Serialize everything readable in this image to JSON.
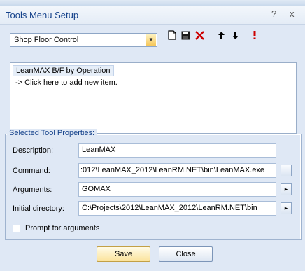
{
  "window": {
    "title": "Tools Menu Setup",
    "help_glyph": "?",
    "close_glyph": "x"
  },
  "group_combo": {
    "selected": "Shop Floor Control"
  },
  "tools_list": {
    "items": [
      "LeanMAX B/F by Operation"
    ],
    "add_item_hint": "-> Click here to add new item."
  },
  "properties": {
    "legend": "Selected Tool Properties:",
    "description": {
      "label": "Description:",
      "value": "LeanMAX"
    },
    "command": {
      "label": "Command:",
      "value": ":012\\LeanMAX_2012\\LeanRM.NET\\bin\\LeanMAX.exe"
    },
    "arguments": {
      "label": "Arguments:",
      "value": "GOMAX"
    },
    "initial_directory": {
      "label": "Initial directory:",
      "value": "C:\\Projects\\2012\\LeanMAX_2012\\LeanRM.NET\\bin"
    },
    "prompt": {
      "label": "Prompt for arguments",
      "checked": false
    },
    "browse_glyph": "...",
    "arrow_glyph": "▸"
  },
  "buttons": {
    "save": "Save",
    "close": "Close"
  },
  "colors": {
    "delete": "#cc0000",
    "exclaim": "#cc0000",
    "accent": "#15428b"
  }
}
